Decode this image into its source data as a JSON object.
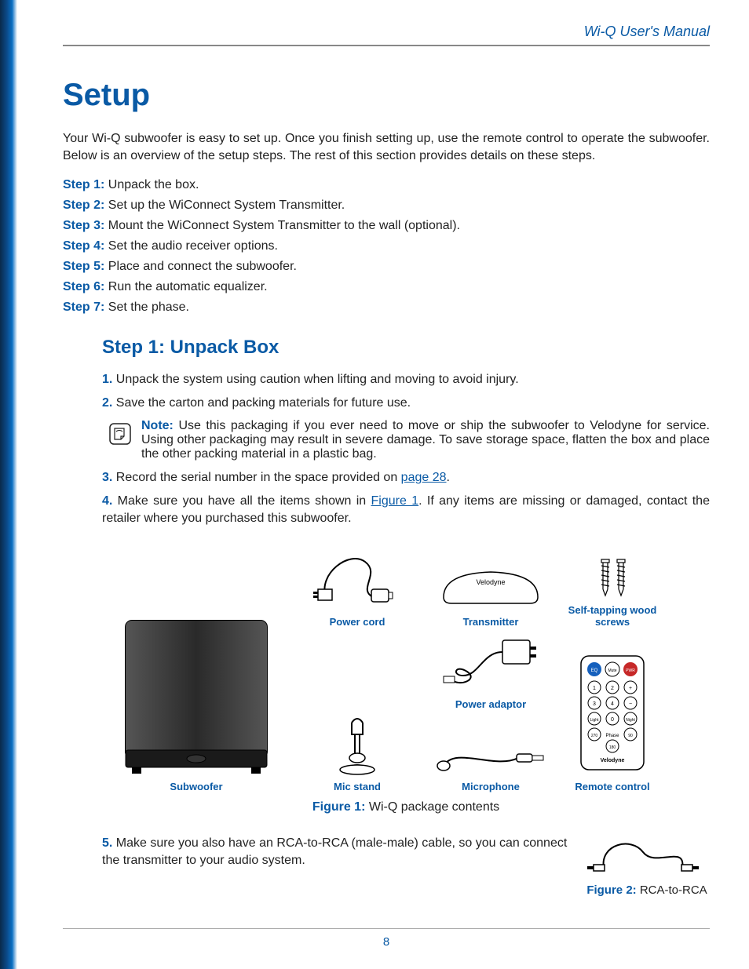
{
  "header": {
    "manual_title": "Wi-Q User's Manual"
  },
  "title": "Setup",
  "intro": "Your Wi-Q subwoofer is easy to set up. Once you finish setting up, use the remote control to operate the subwoofer. Below is an overview of the setup steps. The rest of this section provides details on these steps.",
  "steps": [
    {
      "label": "Step 1:",
      "text": "Unpack the box."
    },
    {
      "label": "Step 2:",
      "text": "Set up the WiConnect System Transmitter."
    },
    {
      "label": "Step 3:",
      "text": "Mount the WiConnect System Transmitter to the wall (optional)."
    },
    {
      "label": "Step 4:",
      "text": "Set the audio receiver options."
    },
    {
      "label": "Step 5:",
      "text": "Place and connect the subwoofer."
    },
    {
      "label": "Step 6:",
      "text": "Run the automatic equalizer."
    },
    {
      "label": "Step 7:",
      "text": "Set the phase."
    }
  ],
  "section1": {
    "heading": "Step 1: Unpack Box",
    "items": {
      "i1": {
        "num": "1.",
        "text": "Unpack the system using caution when lifting and moving to avoid injury."
      },
      "i2": {
        "num": "2.",
        "text": "Save the carton and packing materials for future use."
      },
      "note": {
        "label": "Note:",
        "text": "Use this packaging if you ever need to move or ship the subwoofer to Velodyne for service. Using other packaging may result in severe damage. To save storage space, flatten the box and place the other packing material in a plastic bag."
      },
      "i3": {
        "num": "3.",
        "pre": "Record the serial number in the space provided on ",
        "link": "page 28",
        "post": "."
      },
      "i4": {
        "num": "4.",
        "pre": "Make sure you have all the items shown in ",
        "link": "Figure 1",
        "post": ". If any items are missing or damaged, contact the retailer where you purchased this subwoofer."
      },
      "i5": {
        "num": "5.",
        "text": "Make sure you also have an RCA-to-RCA (male-male) cable, so you can connect the transmitter to your audio system."
      }
    }
  },
  "figure1": {
    "labels": {
      "subwoofer": "Subwoofer",
      "power_cord": "Power cord",
      "transmitter": "Transmitter",
      "screws": "Self-tapping wood screws",
      "power_adaptor": "Power adaptor",
      "mic_stand": "Mic stand",
      "microphone": "Microphone",
      "remote": "Remote control"
    },
    "caption_label": "Figure 1:",
    "caption_text": "Wi-Q package contents",
    "remote_buttons": {
      "eq": "EQ",
      "mute": "Mute",
      "pwr": "PWR",
      "light": "Light",
      "night": "Night",
      "phase": "Phase",
      "brand": "Velodyne"
    }
  },
  "figure2": {
    "caption_label": "Figure 2:",
    "caption_text": "RCA-to-RCA"
  },
  "page_number": "8",
  "colors": {
    "accent": "#0a5aa5"
  }
}
